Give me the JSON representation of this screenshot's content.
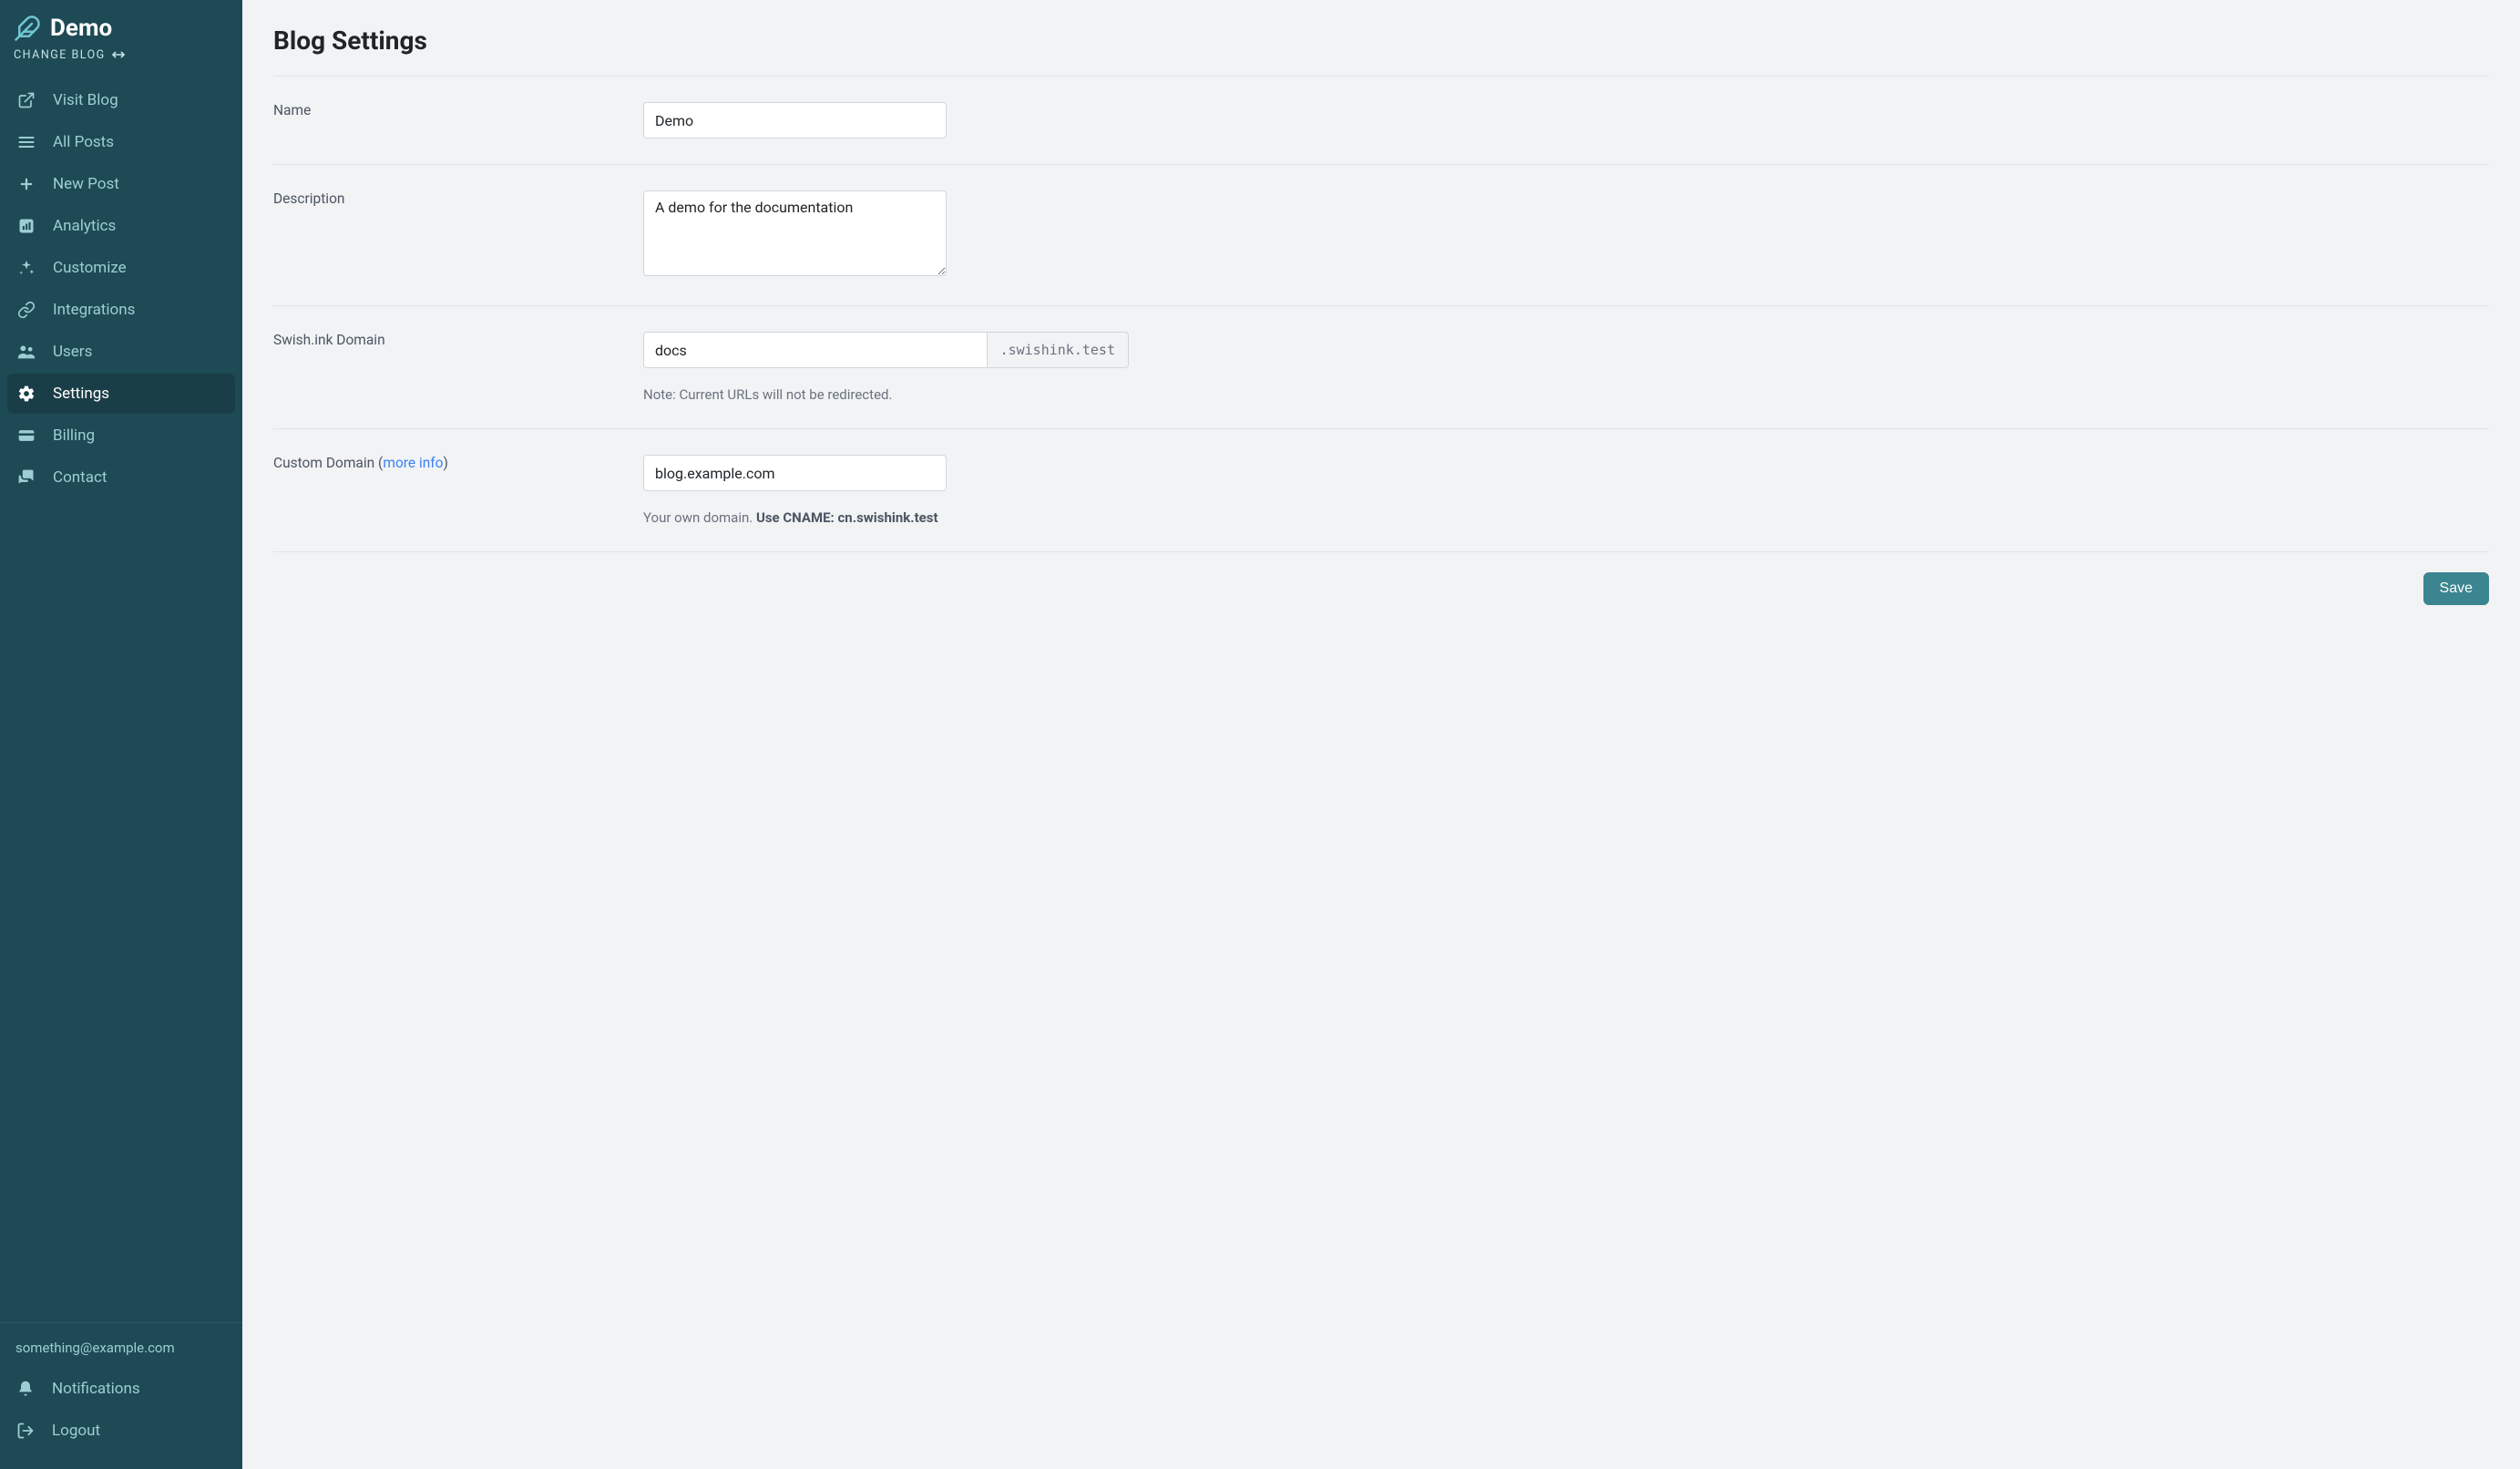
{
  "sidebar": {
    "brand": "Demo",
    "change_blog": "CHANGE BLOG",
    "items": [
      {
        "label": "Visit Blog"
      },
      {
        "label": "All Posts"
      },
      {
        "label": "New Post"
      },
      {
        "label": "Analytics"
      },
      {
        "label": "Customize"
      },
      {
        "label": "Integrations"
      },
      {
        "label": "Users"
      },
      {
        "label": "Settings"
      },
      {
        "label": "Billing"
      },
      {
        "label": "Contact"
      }
    ],
    "user_email": "something@example.com",
    "bottom_items": [
      {
        "label": "Notifications"
      },
      {
        "label": "Logout"
      }
    ]
  },
  "page": {
    "title": "Blog Settings",
    "fields": {
      "name": {
        "label": "Name",
        "value": "Demo"
      },
      "description": {
        "label": "Description",
        "value": "A demo for the documentation"
      },
      "swish_domain": {
        "label": "Swish.ink Domain",
        "value": "docs",
        "suffix": ".swishink.test",
        "note": "Note: Current URLs will not be redirected."
      },
      "custom_domain": {
        "label_prefix": "Custom Domain (",
        "more_info": "more info",
        "label_suffix": ")",
        "value": "blog.example.com",
        "help_prefix": "Your own domain. ",
        "help_bold": "Use CNAME: cn.swishink.test"
      }
    },
    "save": "Save"
  }
}
